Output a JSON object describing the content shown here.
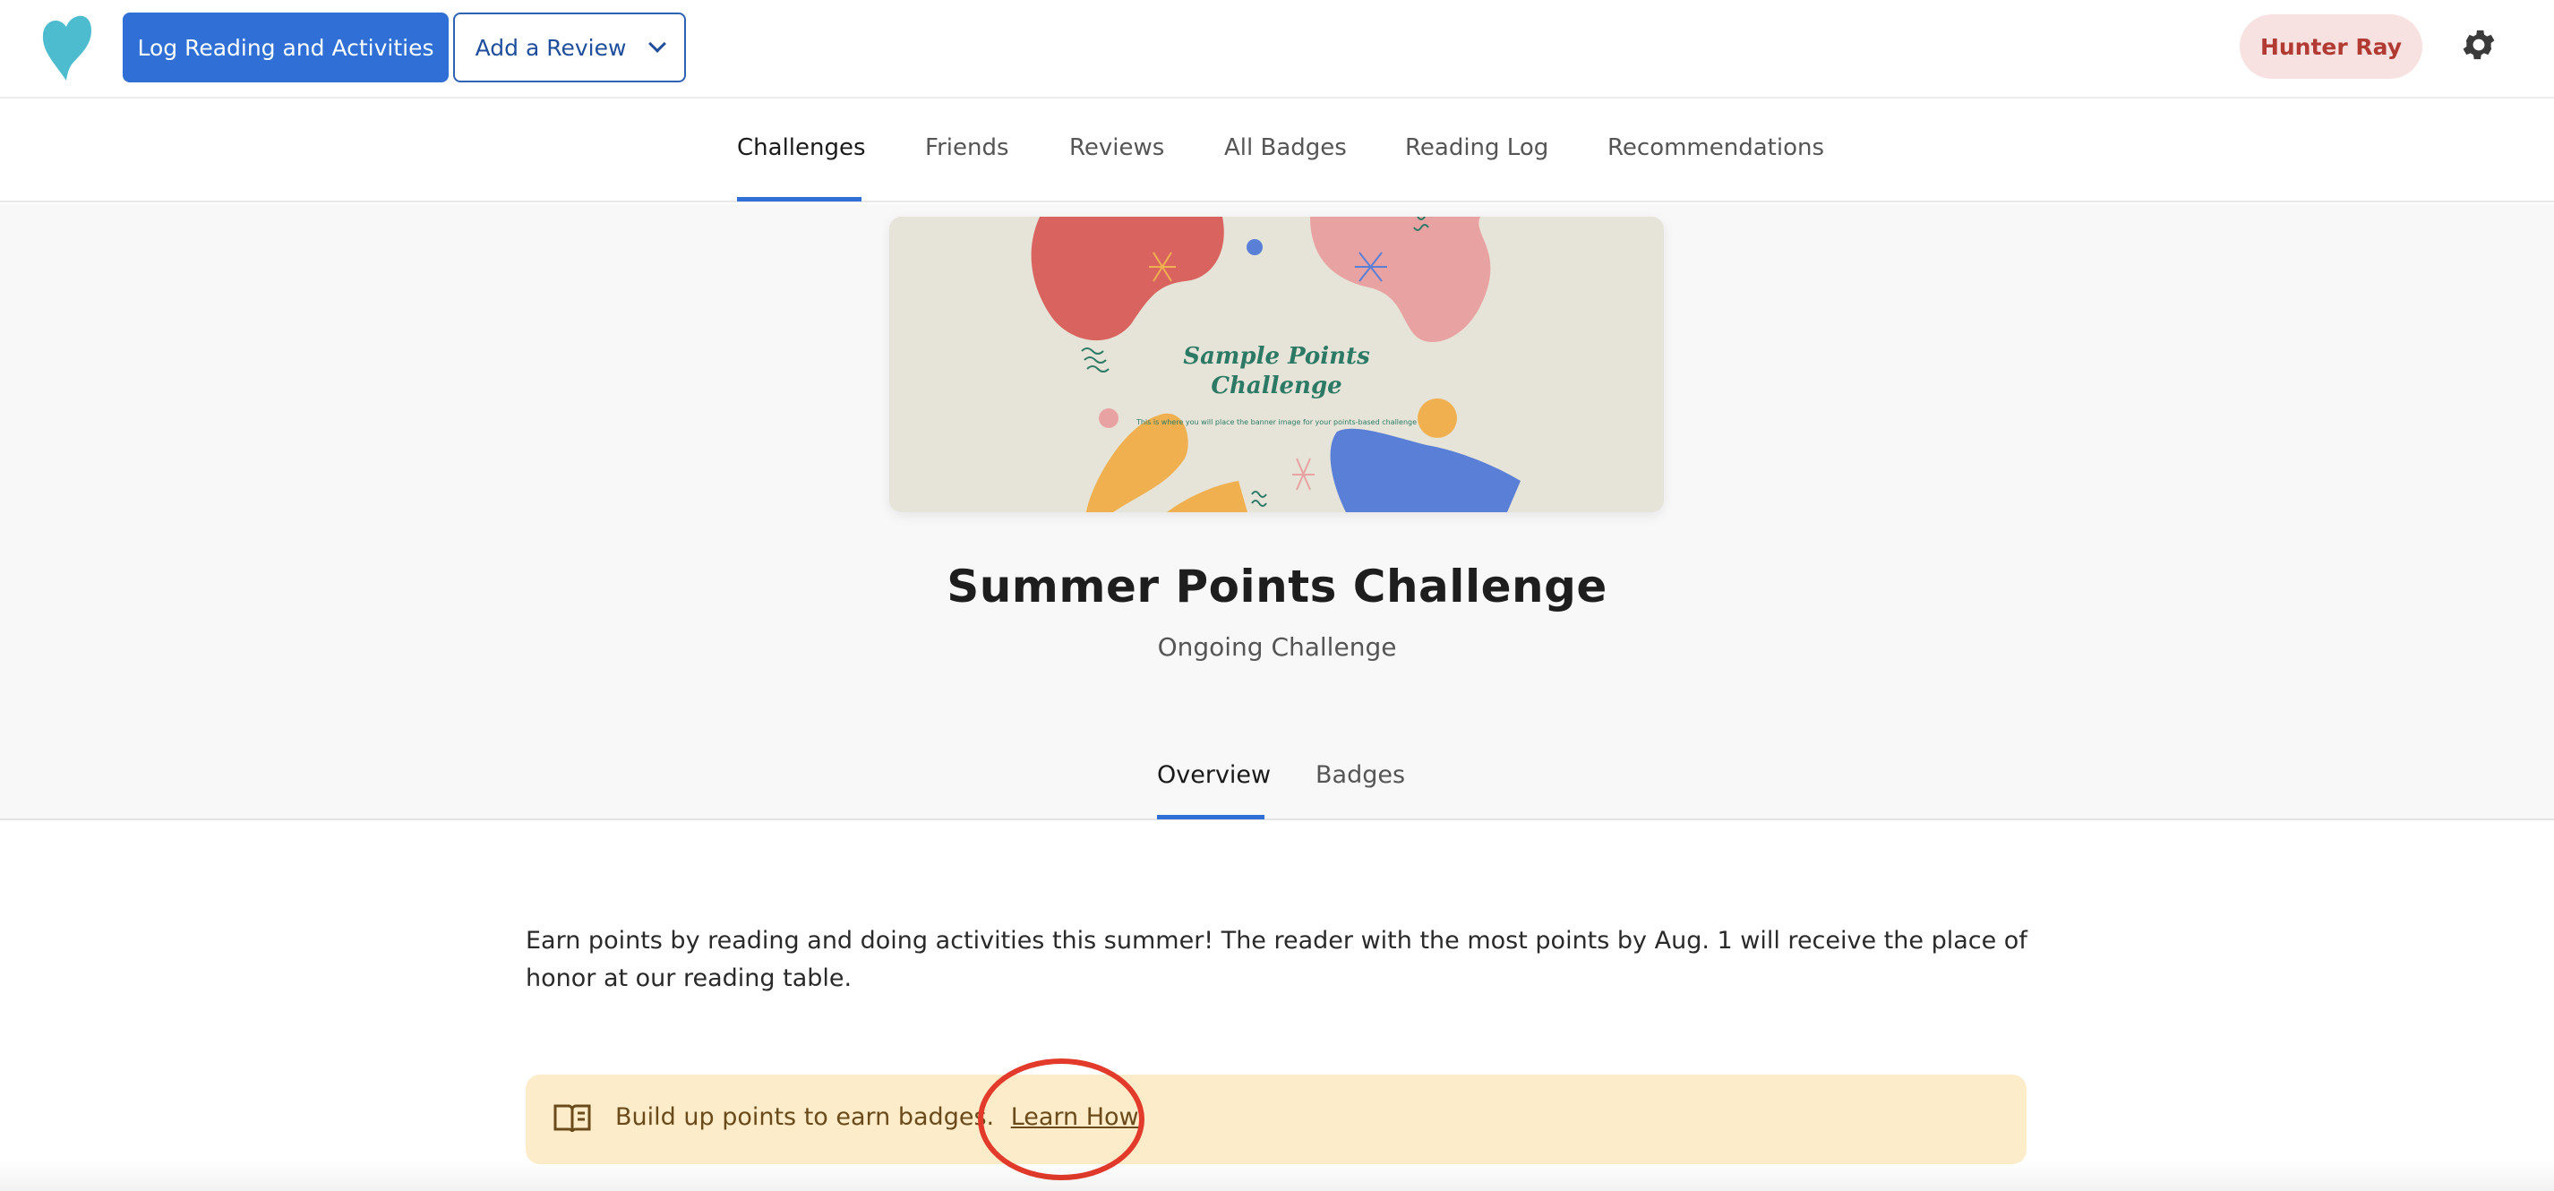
{
  "header": {
    "log_button": "Log Reading and Activities",
    "review_button": "Add a Review",
    "user_name": "Hunter Ray"
  },
  "nav": {
    "items": [
      {
        "label": "Challenges",
        "active": true
      },
      {
        "label": "Friends"
      },
      {
        "label": "Reviews"
      },
      {
        "label": "All Badges"
      },
      {
        "label": "Reading Log"
      },
      {
        "label": "Recommendations"
      }
    ]
  },
  "banner": {
    "title_line1": "Sample Points",
    "title_line2": "Challenge",
    "subtitle": "This is where you will place the banner image for your points-based challenge"
  },
  "challenge": {
    "title": "Summer Points Challenge",
    "status": "Ongoing Challenge"
  },
  "tabs": [
    {
      "label": "Overview",
      "active": true
    },
    {
      "label": "Badges"
    }
  ],
  "description": "Earn points by reading and doing activities this summer! The reader with the most points by Aug. 1 will receive the place of honor at our reading table.",
  "notice": {
    "text": "Build up points to earn badges.",
    "link": "Learn How"
  },
  "colors": {
    "primary": "#2f6fd6",
    "user_pill_bg": "#f8e2e1",
    "notice_bg": "#fcecc9",
    "highlight": "#e23a2b"
  },
  "icons": [
    "heart-logo-icon",
    "chevron-down-icon",
    "gear-icon",
    "book-icon"
  ]
}
